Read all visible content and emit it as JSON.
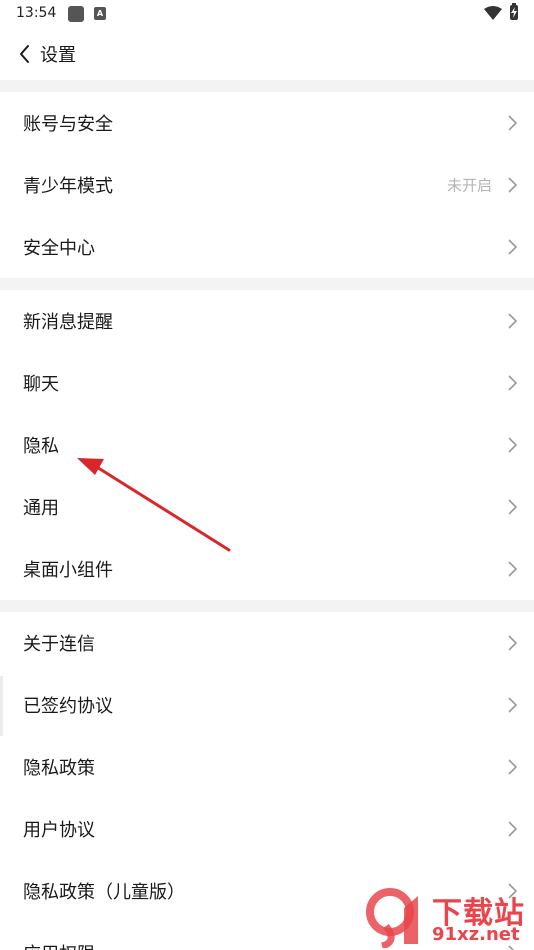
{
  "status_bar": {
    "time": "13:54",
    "notification_badge": "A"
  },
  "header": {
    "title": "设置"
  },
  "groups": [
    {
      "items": [
        {
          "label": "账号与安全",
          "value": ""
        },
        {
          "label": "青少年模式",
          "value": "未开启"
        },
        {
          "label": "安全中心",
          "value": ""
        }
      ]
    },
    {
      "items": [
        {
          "label": "新消息提醒",
          "value": ""
        },
        {
          "label": "聊天",
          "value": ""
        },
        {
          "label": "隐私",
          "value": ""
        },
        {
          "label": "通用",
          "value": ""
        },
        {
          "label": "桌面小组件",
          "value": ""
        }
      ]
    },
    {
      "items": [
        {
          "label": "关于连信",
          "value": ""
        },
        {
          "label": "已签约协议",
          "value": ""
        },
        {
          "label": "隐私政策",
          "value": ""
        },
        {
          "label": "用户协议",
          "value": ""
        },
        {
          "label": "隐私政策（儿童版）",
          "value": ""
        },
        {
          "label": "应用权限",
          "value": ""
        }
      ]
    }
  ],
  "annotation": {
    "color": "#d9262b",
    "points_to": "隐私"
  },
  "watermark": {
    "title": "下载站",
    "domain": "91xz.net",
    "color": "#e8464c"
  },
  "colors": {
    "background": "#ffffff",
    "separator": "#f3f3f3",
    "secondary_text": "#b5b5b5",
    "chevron": "#9a9a9a"
  }
}
